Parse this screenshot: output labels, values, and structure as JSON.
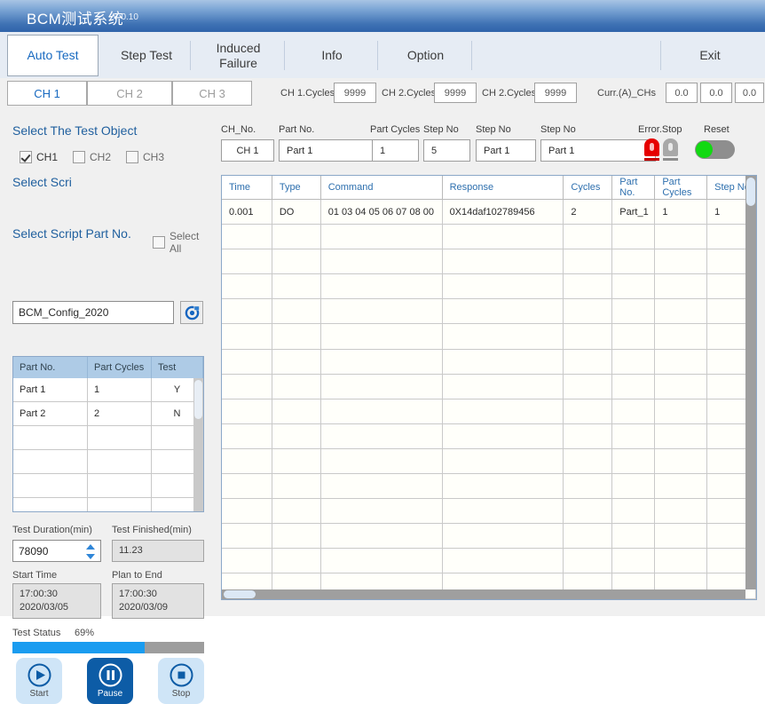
{
  "window": {
    "title": "BCM测试系统",
    "version": "V 0.10"
  },
  "tabs": [
    {
      "label": "Auto Test",
      "active": true
    },
    {
      "label": "Step Test",
      "active": false
    },
    {
      "label": "Induced\nFailure",
      "active": false
    },
    {
      "label": "Info",
      "active": false
    },
    {
      "label": "Option",
      "active": false
    },
    {
      "label": "",
      "active": false
    },
    {
      "label": "Exit",
      "active": false
    }
  ],
  "tab_labels": {
    "auto_test": "Auto Test",
    "step_test": "Step Test",
    "induced_failure_line1": "Induced",
    "induced_failure_line2": "Failure",
    "info": "Info",
    "option": "Option",
    "exit": "Exit"
  },
  "channel_bar": {
    "channels": [
      {
        "label": "CH 1",
        "active": true
      },
      {
        "label": "CH 2",
        "active": false
      },
      {
        "label": "CH 3",
        "active": false
      }
    ],
    "ch_labels": {
      "ch1": "CH 1",
      "ch2": "CH 2",
      "ch3": "CH 3"
    },
    "cycles": [
      {
        "label": "CH 1.Cycles",
        "value": "9999"
      },
      {
        "label": "CH 2.Cycles",
        "value": "9999"
      },
      {
        "label": "CH 2.Cycles",
        "value": "9999"
      }
    ],
    "cycle_fields": {
      "l1": "CH 1.Cycles",
      "v1": "9999",
      "l2": "CH 2.Cycles",
      "v2": "9999",
      "l3": "CH 2.Cycles",
      "v3": "9999"
    },
    "current": {
      "label": "Curr.(A)_CHs",
      "values": [
        "0.0",
        "0.0",
        "0.0"
      ],
      "v1": "0.0",
      "v2": "0.0",
      "v3": "0.0"
    }
  },
  "left_panel": {
    "test_object_title": "Select The Test Object",
    "checkboxes": [
      {
        "label": "CH1",
        "checked": true
      },
      {
        "label": "CH2",
        "checked": false
      },
      {
        "label": "CH3",
        "checked": false
      }
    ],
    "cb": {
      "ch1": "CH1",
      "ch2": "CH2",
      "ch3": "CH3"
    },
    "select_script_title": "Select Scri",
    "script_value": "BCM_Config_2020",
    "script_button_icon": "browse-icon",
    "select_part_title": "Select Script Part No.",
    "select_all_label": "Select All",
    "select_all_checked": false,
    "part_table": {
      "headers": [
        "Part No.",
        "Part Cycles",
        "Test"
      ],
      "h1": "Part No.",
      "h2": "Part Cycles",
      "h3": "Test",
      "rows": [
        {
          "part_no": "Part 1",
          "part_cycles": "1",
          "test": "Y"
        },
        {
          "part_no": "Part 2",
          "part_cycles": "2",
          "test": "N"
        }
      ],
      "empty_row_count": 5
    },
    "duration_label": "Test Duration(min)",
    "duration_value": "78090",
    "finished_label": "Test Finished(min)",
    "finished_value": "11.23",
    "start_time_label": "Start Time",
    "start_time_value": "17:00:30\n2020/03/05",
    "start_time_line1": "17:00:30",
    "start_time_line2": "2020/03/05",
    "plan_end_label": "Plan to End",
    "plan_end_line1": "17:00:30",
    "plan_end_line2": "2020/03/09",
    "status_label": "Test Status",
    "status_percent": "69%",
    "progress_value": 69,
    "buttons": {
      "start": "Start",
      "pause": "Pause",
      "stop": "Stop"
    }
  },
  "right_panel": {
    "fields": {
      "ch_no_label": "CH_No.",
      "ch_no_value": "CH 1",
      "part_no_label": "Part No.",
      "part_no_value": "Part 1",
      "part_cycles_label": "Part Cycles",
      "part_cycles_value": "1",
      "step_no_label": "Step No",
      "step_no_value": "5",
      "step_no2_label": "Step No",
      "step_no2_value": "Part 1",
      "step_no3_label": "Step No",
      "step_no3_value": "Part 1"
    },
    "error_stop_label": "Error.Stop",
    "reset_label": "Reset",
    "lamp_on_color": "#e60000",
    "lamp_off_color": "#a8a8a8",
    "toggle_on_color": "#12d912",
    "grid": {
      "headers": [
        "Time",
        "Type",
        "Command",
        "Response",
        "Cycles",
        "Part No.",
        "Part Cycles",
        "Step No"
      ],
      "h1": "Time",
      "h2": "Type",
      "h3": "Command",
      "h4": "Response",
      "h5": "Cycles",
      "h6": "Part No.",
      "h7": "Part Cycles",
      "h8": "Step No",
      "rows": [
        {
          "time": "0.001",
          "type": "DO",
          "command": "01 03 04 05 06 07 08 00",
          "response": "0X14daf102789456",
          "cycles": "2",
          "part_no": "Part_1",
          "part_cycles": "1",
          "step_no": "1"
        }
      ],
      "empty_row_count": 15
    }
  },
  "colors": {
    "title_blue": "#3f72b4",
    "accent_blue": "#1769c0",
    "header_blue": "#aecbe6",
    "progress_blue": "#1a9cf0"
  }
}
